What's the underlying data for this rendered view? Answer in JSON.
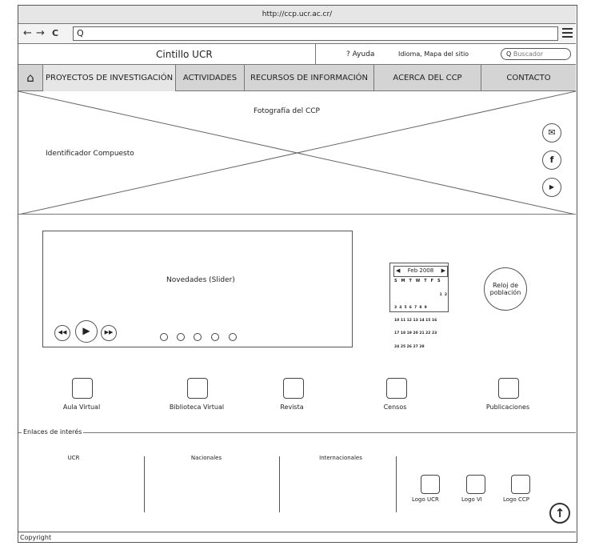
{
  "browser": {
    "url": "http://ccp.ucr.ac.cr/",
    "back_icon": "←",
    "forward_icon": "→",
    "reload_icon": "C",
    "search_icon": "Q"
  },
  "header": {
    "cintillo": "Cintillo UCR",
    "ayuda": "? Ayuda",
    "idioma": "Idioma, Mapa del sitio",
    "search_placeholder": "Buscador"
  },
  "menu": {
    "home_icon": "⌂",
    "items": [
      "PROYECTOS DE INVESTIGACIÓN",
      "ACTIVIDADES",
      "RECURSOS DE INFORMACIÓN",
      "ACERCA DEL CCP",
      "CONTACTO"
    ]
  },
  "hero": {
    "photo_label": "Fotografía del CCP",
    "identifier": "Identificador Compuesto",
    "social": [
      "mail-icon",
      "facebook-icon",
      "youtube-icon"
    ]
  },
  "slider": {
    "label": "Novedades (Slider)",
    "dots": 5
  },
  "calendar": {
    "month": "Feb 2008",
    "weekdays": "S M T W T F S",
    "weeks": [
      "                 1  2",
      "3  4  5  6  7  8  9",
      "10 11 12 13 14 15 16",
      "17 18 19 20 21 22 23",
      "24 25 26 27 28"
    ]
  },
  "clock": {
    "line1": "Reloj de",
    "line2": "población"
  },
  "tiles": [
    "Aula Virtual",
    "Biblioteca Virtual",
    "Revista",
    "Censos",
    "Publicaciones"
  ],
  "links": {
    "legend": "Enlaces de interés",
    "columns": [
      "UCR",
      "Nacionales",
      "Internacionales"
    ],
    "logos": [
      "Logo UCR",
      "Logo VI",
      "Logo CCP"
    ]
  },
  "footer": {
    "copyright": "Copyright"
  },
  "colors": {
    "menu_bg": "#d4d4d4",
    "border": "#555555"
  }
}
